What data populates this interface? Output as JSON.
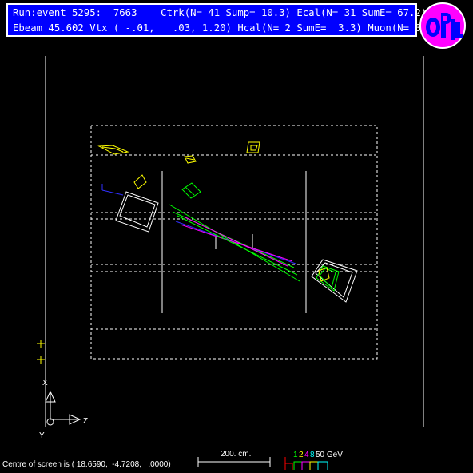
{
  "header": {
    "line1": "Run:event 5295:  7663    Ctrk(N= 41 Sump= 10.3) Ecal(N= 31 SumE= 67.2)",
    "line2": "Ebeam 45.602 Vtx ( -.01,   .03, 1.20) Hcal(N= 2 SumE=  3.3) Muon(N= 0)"
  },
  "logo": {
    "text": "OPAL",
    "bg": "#ff00ff",
    "fg": "#0000ff"
  },
  "axes": {
    "x_label": "X",
    "y_label": "Y",
    "z_label": "Z"
  },
  "scale": {
    "label": "200. cm."
  },
  "energy_legend": {
    "values": [
      "1",
      "2",
      "4",
      "8",
      "50 GeV"
    ],
    "colors": [
      "#00ff00",
      "#ffff00",
      "#ff00ff",
      "#00ffff",
      "#ffffff"
    ]
  },
  "footer": {
    "centre_text": "Centre of screen is ( 18.6590,  -4.7208,   .0000)"
  },
  "colors": {
    "background": "#000000",
    "detector": "#ffffff",
    "track_green": "#00ff00",
    "track_blue": "#3030ff",
    "track_magenta": "#ff00ff",
    "cluster_yellow": "#ffff00",
    "header_bg": "#0000ff"
  }
}
